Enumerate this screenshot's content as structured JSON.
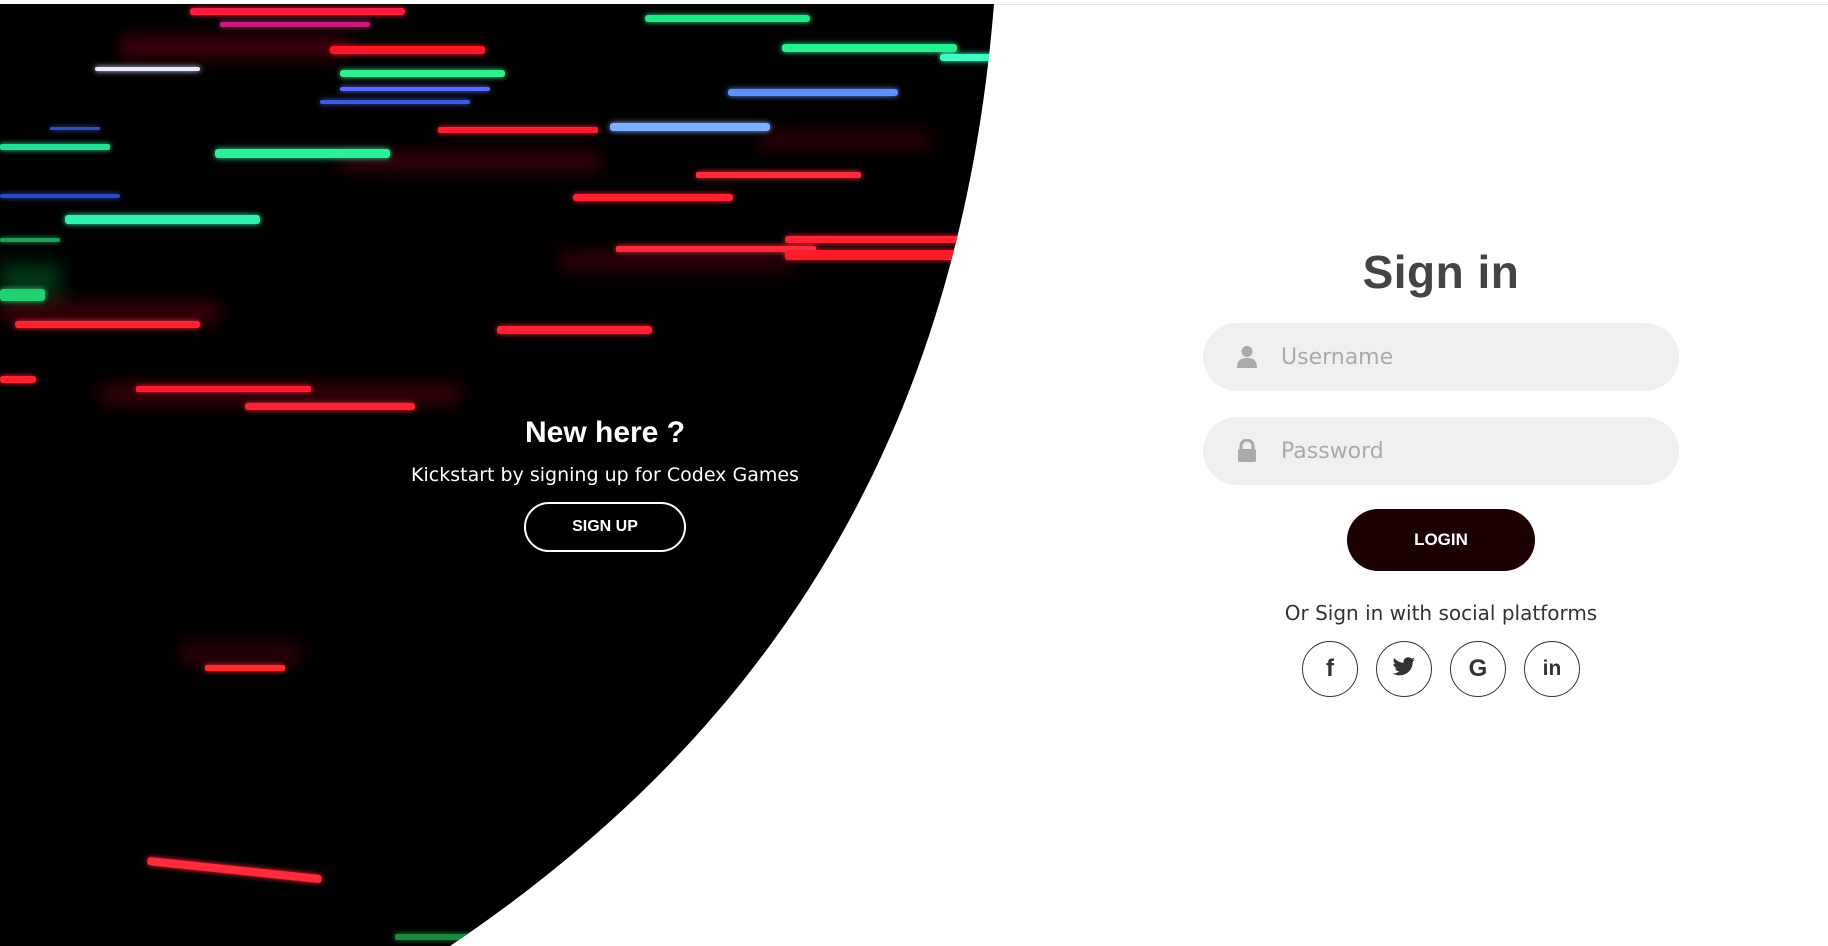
{
  "panel": {
    "title": "New here ?",
    "description": "Kickstart by signing up for Codex Games",
    "signup_label": "SIGN UP"
  },
  "form": {
    "title": "Sign in",
    "username_placeholder": "Username",
    "password_placeholder": "Password",
    "login_label": "LOGIN",
    "social_text": "Or Sign in with social platforms",
    "social": [
      {
        "name": "facebook",
        "glyph": "f"
      },
      {
        "name": "twitter",
        "glyph": ""
      },
      {
        "name": "google",
        "glyph": "G"
      },
      {
        "name": "linkedin",
        "glyph": "in"
      }
    ]
  },
  "colors": {
    "panel_bg": "#000000",
    "login_bg": "#1c0202",
    "field_bg": "#f0f0f0",
    "title": "#444444"
  }
}
